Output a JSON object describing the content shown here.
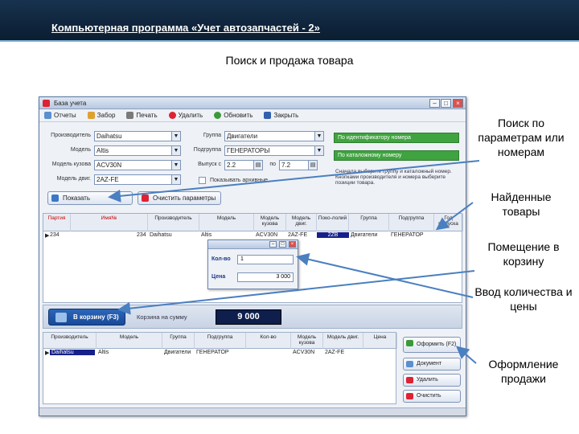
{
  "slide": {
    "title": "Компьютерная программа «Учет автозапчастей - 2»",
    "subtitle": "Поиск и продажа товара"
  },
  "window": {
    "title": "База учета",
    "toolbar": [
      "Отчеты",
      "Забор",
      "Печать",
      "Удалить",
      "Обновить",
      "Закрыть"
    ],
    "filters": {
      "manufacturer_label": "Производитель",
      "manufacturer": "Daihatsu",
      "model_label": "Модель",
      "model": "Altis",
      "body_label": "Модель кузова",
      "body": "ACV30N",
      "engine_label": "Модель двиг.",
      "engine": "2AZ-FE",
      "group_label": "Группа",
      "group": "Двигатели",
      "subgroup_label": "Подгруппа",
      "subgroup": "ГЕНЕРАТОРЫ",
      "year_label": "Выпуск с",
      "year_from": "2.2",
      "year_to_label": "по",
      "year_to": "7.2",
      "checkbox_label": "Показывать архивные",
      "search_part_button": "По идентификатору номера",
      "search_code_button": "По каталожному номеру",
      "hint": "Сначала выберите группу и каталожный номер. Кнопками производителя и номера выберите позиции товара."
    },
    "buttons": {
      "show": "Показать",
      "clear": "Очистить параметры"
    },
    "grid": {
      "headers": [
        "Партия",
        "Имя№",
        "Производитель",
        "Модель",
        "Модель кузова",
        "Модель двиг.",
        "Поко-лолий",
        "Группа",
        "Подгруппа",
        "Год выпуска"
      ],
      "row": [
        "234",
        "234",
        "Daihatsu",
        "Altis",
        "ACV30N",
        "2AZ-FE",
        "2ZB",
        "Двигатели",
        "ГЕНЕРАТОР"
      ]
    },
    "qty_dialog": {
      "qty_label": "Кол-во",
      "qty": "1",
      "price_label": "Цена",
      "price": "3 000"
    },
    "cart": {
      "button": "В корзину (F3)",
      "sum_label": "Корзина на сумму",
      "sum": "9 000"
    },
    "cart_grid": {
      "headers": [
        "Производитель",
        "Модель",
        "Группа",
        "Подгруппа",
        "Кол-во",
        "Модель кузова",
        "Модель двиг.",
        "Цена"
      ],
      "row": [
        "Daihatsu",
        "Altis",
        "Двигатели",
        "ГЕНЕРАТОР",
        "",
        "ACV30N",
        "2AZ-FE",
        ""
      ]
    },
    "side_buttons": {
      "checkout": "Оформить (F2)",
      "document": "Документ",
      "delete": "Удалить",
      "clear": "Очистить"
    }
  },
  "annotations": {
    "search": "Поиск по параметрам или номерам",
    "found": "Найденные товары",
    "to_cart": "Помещение в корзину",
    "qty_price": "Ввод количества и цены",
    "checkout": "Оформление продажи"
  },
  "colors": {
    "header_bg": "#0b1d30",
    "accent_green": "#3fa43f",
    "arrow": "#4a7fc0",
    "cart_button": "#184a98"
  }
}
